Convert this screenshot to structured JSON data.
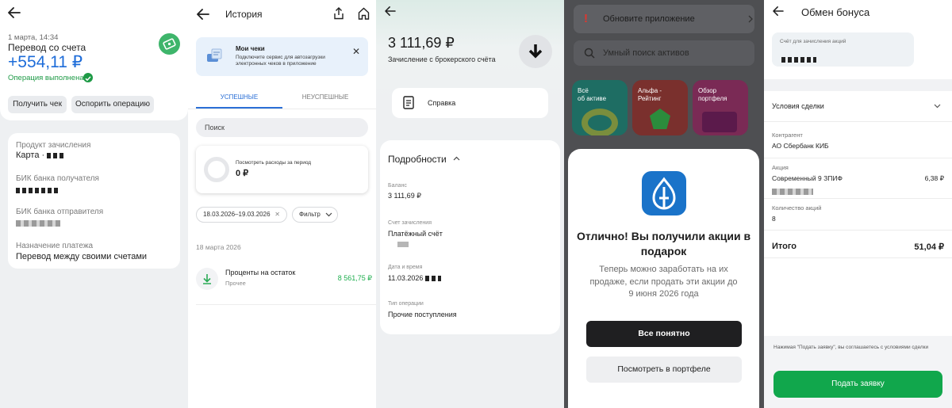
{
  "colors": {
    "accent_green": "#11a74c",
    "success_green": "#1e9a46",
    "dark_button": "#1f1f21",
    "gazprom_blue": "#1a73c9",
    "amount_blue": "#1d6cd9"
  },
  "panel1": {
    "datetime": "1 марта, 14:34",
    "title": "Перевод со счета",
    "amount": "+554,11 ₽",
    "status": "Операция выполнена",
    "btn_receipt": "Получить чек",
    "btn_dispute": "Оспорить операцию",
    "fields": [
      {
        "label": "Продукт зачисления",
        "value": "Карта ·"
      },
      {
        "label": "БИК банка получателя",
        "value": ""
      },
      {
        "label": "БИК банка отправителя",
        "value": ""
      },
      {
        "label": "Назначение платежа",
        "value": "Перевод между своими счетами"
      }
    ]
  },
  "panel2": {
    "title": "История",
    "promo_title": "Мои чеки",
    "promo_text": "Подключите сервис для автозагрузки электронных чеков в приложение",
    "tab_success": "УСПЕШНЫЕ",
    "tab_fail": "НЕУСПЕШНЫЕ",
    "search_placeholder": "Поиск",
    "spend_label": "Посмотреть расходы за период",
    "spend_value": "0 ₽",
    "date_chip": "18.03.2026–19.03.2026",
    "filter_label": "Фильтр",
    "section_date": "18 марта 2026",
    "txn_title": "Проценты на остаток",
    "txn_category": "Прочее",
    "txn_amount": "8 561,75 ₽"
  },
  "panel3": {
    "amount": "3 111,69 ₽",
    "subtitle": "Зачисление с брокерского счёта",
    "spravka": "Справка",
    "details_title": "Подробности",
    "balance_label": "Баланс",
    "balance_value": "3 111,69 ₽",
    "account_label": "Счет зачисления",
    "account_value": "Платёжный счёт",
    "datetime_label": "Дата и время",
    "datetime_value": "11.03.2026",
    "optype_label": "Тип операции",
    "optype_value": "Прочие поступления"
  },
  "panel4": {
    "banner": "Обновите приложение",
    "search": "Умный поиск активов",
    "tiles": [
      {
        "label": "Всё\nоб активе",
        "bg": "#27b39a"
      },
      {
        "label": "Альфа -\nРейтинг",
        "bg": "#d8403a"
      },
      {
        "label": "Обзор\nпортфеля",
        "bg": "#c43f86"
      }
    ],
    "modal_title": "Отлично! Вы получили акции в подарок",
    "modal_text": "Теперь можно заработать на их продаже, если продать эти акции до 9 июня 2026 года",
    "btn_ok": "Все понятно",
    "btn_portfolio": "Посмотреть в портфеле"
  },
  "panel5": {
    "title": "Обмен бонуса",
    "acct_label": "Счёт для зачисления акций",
    "deal_terms": "Условия сделки",
    "counterparty_label": "Контрагент",
    "counterparty_value": "АО Сбербанк КИБ",
    "stock_label": "Акция",
    "stock_value": "Современный 9 ЗПИФ",
    "stock_price": "6,38 ₽",
    "qty_label": "Количество акций",
    "qty_value": "8",
    "total_label": "Итого",
    "total_value": "51,04 ₽",
    "disclaimer": "Нажимая \"Подать заявку\", вы соглашаетесь с условиями сделки",
    "submit": "Подать заявку"
  }
}
